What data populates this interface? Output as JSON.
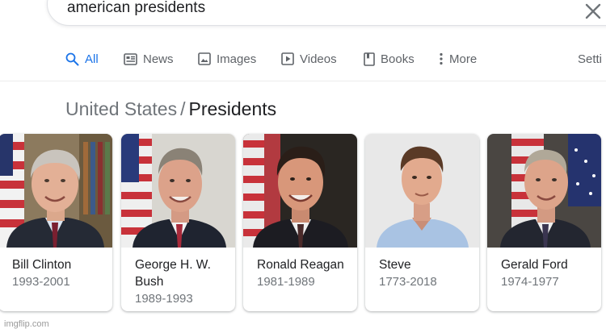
{
  "search": {
    "query": "american presidents"
  },
  "tabs": [
    {
      "label": "All",
      "icon": "search-icon",
      "active": true
    },
    {
      "label": "News",
      "icon": "news-icon"
    },
    {
      "label": "Images",
      "icon": "image-icon"
    },
    {
      "label": "Videos",
      "icon": "video-icon"
    },
    {
      "label": "Books",
      "icon": "book-icon"
    },
    {
      "label": "More",
      "icon": "more-vert-icon"
    }
  ],
  "settings_label": "Setti",
  "breadcrumb": {
    "parent": "United States",
    "separator": "/",
    "current": "Presidents"
  },
  "cards": [
    {
      "name": "Bill Clinton",
      "years": "1993-2001"
    },
    {
      "name": "George H. W. Bush",
      "years": "1989-1993"
    },
    {
      "name": "Ronald Reagan",
      "years": "1981-1989"
    },
    {
      "name": "Steve",
      "years": "1773-2018"
    },
    {
      "name": "Gerald Ford",
      "years": "1974-1977"
    }
  ],
  "watermark": "imgflip.com",
  "colors": {
    "accent": "#1a73e8",
    "text_secondary": "#70757a",
    "text_primary": "#202124"
  }
}
